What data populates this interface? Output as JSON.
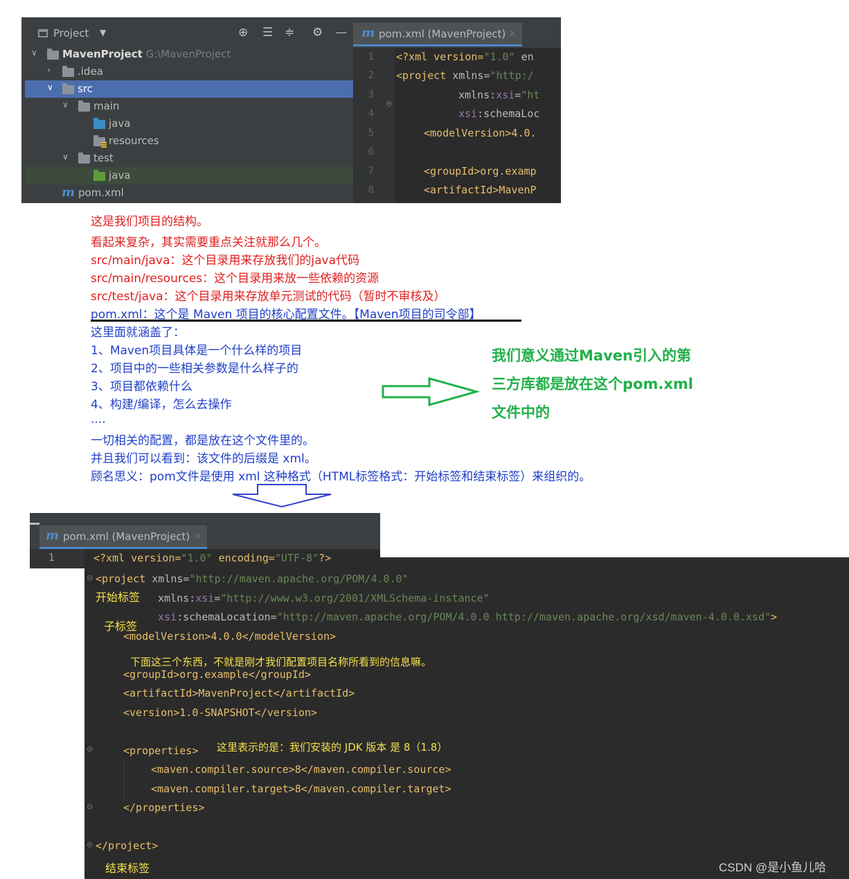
{
  "top_ide": {
    "panel_title": "Project",
    "tree": [
      {
        "name": "MavenProject",
        "path": "G:\\MavenProject"
      },
      {
        "name": ".idea"
      },
      {
        "name": "src"
      },
      {
        "name": "main"
      },
      {
        "name": "java"
      },
      {
        "name": "resources"
      },
      {
        "name": "test"
      },
      {
        "name": "java"
      },
      {
        "name": "pom.xml"
      }
    ],
    "tab": "pom.xml (MavenProject)",
    "line_numbers": [
      "1",
      "2",
      "3",
      "4",
      "5",
      "6",
      "7",
      "8"
    ],
    "code": {
      "l1a": "<?xml version=",
      "l1b": "\"1.0\"",
      "l1c": " en",
      "l2a": "<project ",
      "l2b": "xmlns=",
      "l2c": "\"http:/",
      "l3a": "xmlns:",
      "l3b": "xsi",
      "l3c": "=",
      "l3d": "\"ht",
      "l4a": "xsi",
      "l4b": ":schemaLoc",
      "l5": "<modelVersion>4.0.",
      "l7": "<groupId>org.examp",
      "l8": "<artifactId>MavenP"
    }
  },
  "annotations": {
    "red": [
      "这是我们项目的结构。",
      "看起来复杂，其实需要重点关注就那么几个。",
      "src/main/java：这个目录用来存放我们的java代码",
      "src/main/resources：这个目录用来放一些依赖的资源",
      "src/test/java：这个目录用来存放单元测试的代码（暂时不审核及）"
    ],
    "blue": [
      "pom.xml：这个是 Maven 项目的核心配置文件。【Maven项目的司令部】",
      "这里面就涵盖了：",
      "1、Maven项目具体是一个什么样的项目",
      "2、项目中的一些相关参数是什么样子的",
      "3、项目都依赖什么",
      "4、构建/编译，怎么去操作",
      "....",
      "一切相关的配置，都是放在这个文件里的。",
      "并且我们可以看到：该文件的后缀是 xml。",
      "顾名思义：pom文件是使用 xml 这种格式（HTML标签格式：开始标签和结束标签）来组织的。"
    ],
    "green": [
      "我们意义通过Maven引入的第",
      "三方库都是放在这个pom.xml",
      "文件中的"
    ]
  },
  "bottom_ide": {
    "tab": "pom.xml (MavenProject)",
    "line1_number": "1",
    "code": {
      "l1a": "<?xml version=",
      "l1b": "\"1.0\"",
      "l1c": " encoding=",
      "l1d": "\"UTF-8\"",
      "l1e": "?>",
      "l2a": "<project ",
      "l2b": "xmlns=",
      "l2c": "\"http://maven.apache.org/POM/4.0.0\"",
      "l3a": "xmlns:",
      "l3b": "xsi",
      "l3c": "=",
      "l3d": "\"http://www.w3.org/2001/XMLSchema-instance\"",
      "l4a": "xsi",
      "l4b": ":schemaLocation=",
      "l4c": "\"http://maven.apache.org/POM/4.0.0 http://maven.apache.org/xsd/maven-4.0.0.xsd\"",
      "l4d": ">",
      "model": "<modelVersion>4.0.0</modelVersion>",
      "group": "<groupId>org.example</groupId>",
      "artifact": "<artifactId>MavenProject</artifactId>",
      "version": "<version>1.0-SNAPSHOT</version>",
      "props_open": "<properties>",
      "source": "<maven.compiler.source>8</maven.compiler.source>",
      "target": "<maven.compiler.target>8</maven.compiler.target>",
      "props_close": "</properties>",
      "project_close": "</project>"
    },
    "notes": {
      "start_tag": "开始标签",
      "child_tag": "子标签",
      "three_things": "下面这三个东西，不就是刚才我们配置项目名称所看到的信息嘛。",
      "jdk": "这里表示的是：我们安装的 JDK 版本 是 8（1.8）",
      "end_tag": "结束标签"
    }
  },
  "watermark": "CSDN @是小鱼儿哈"
}
